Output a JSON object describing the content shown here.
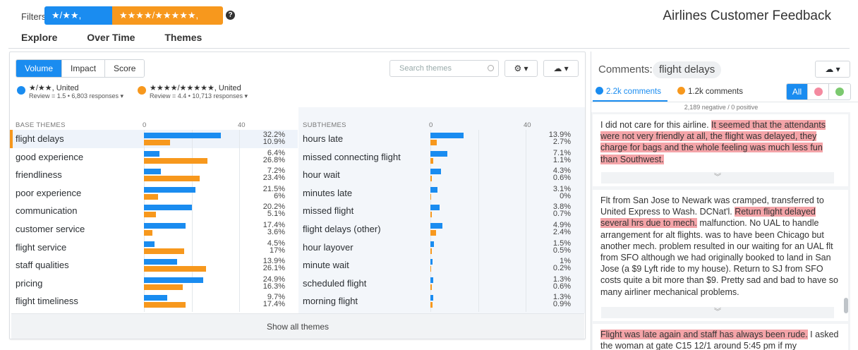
{
  "filters": {
    "label": "Filters",
    "chips": [
      {
        "label": "★/★★, United",
        "color": "#1a8cf0"
      },
      {
        "label": "★★★★/★★★★★, United",
        "color": "#f7981d"
      }
    ],
    "help": "?"
  },
  "app_title": "Airlines Customer Feedback",
  "nav": [
    "Explore",
    "Over Time",
    "Themes"
  ],
  "toolbar": {
    "modes": [
      "Volume",
      "Impact",
      "Score"
    ],
    "active_mode": "Volume",
    "search_placeholder": "Search themes",
    "gear_label": "⚙ ▾",
    "cloud_label": "☁ ▾"
  },
  "legend": [
    {
      "name": "★/★★, United",
      "sub": "Review = 1.5 • 6,803 responses ▾",
      "color": "#1a8cf0"
    },
    {
      "name": "★★★★/★★★★★, United",
      "sub": "Review = 4.4 • 10,713 responses ▾",
      "color": "#f7981d"
    }
  ],
  "base_themes": {
    "header": "BASE THEMES",
    "axis": [
      "0",
      "40"
    ],
    "rows": [
      {
        "label": "flight delays",
        "a": 32.2,
        "b": 10.9,
        "a_text": "32.2%",
        "b_text": "10.9%"
      },
      {
        "label": "good experience",
        "a": 6.4,
        "b": 26.8,
        "a_text": "6.4%",
        "b_text": "26.8%"
      },
      {
        "label": "friendliness",
        "a": 7.2,
        "b": 23.4,
        "a_text": "7.2%",
        "b_text": "23.4%"
      },
      {
        "label": "poor experience",
        "a": 21.5,
        "b": 6,
        "a_text": "21.5%",
        "b_text": "6%"
      },
      {
        "label": "communication",
        "a": 20.2,
        "b": 5.1,
        "a_text": "20.2%",
        "b_text": "5.1%"
      },
      {
        "label": "customer service",
        "a": 17.4,
        "b": 3.6,
        "a_text": "17.4%",
        "b_text": "3.6%"
      },
      {
        "label": "flight service",
        "a": 4.5,
        "b": 17,
        "a_text": "4.5%",
        "b_text": "17%"
      },
      {
        "label": "staff qualities",
        "a": 13.9,
        "b": 26.1,
        "a_text": "13.9%",
        "b_text": "26.1%"
      },
      {
        "label": "pricing",
        "a": 24.9,
        "b": 16.3,
        "a_text": "24.9%",
        "b_text": "16.3%"
      },
      {
        "label": "flight timeliness",
        "a": 9.7,
        "b": 17.4,
        "a_text": "9.7%",
        "b_text": "17.4%"
      }
    ]
  },
  "subthemes": {
    "header": "SUBTHEMES",
    "axis": [
      "0",
      "40"
    ],
    "rows": [
      {
        "label": "hours late",
        "a": 13.9,
        "b": 2.7,
        "a_text": "13.9%",
        "b_text": "2.7%"
      },
      {
        "label": "missed connecting flight",
        "a": 7.1,
        "b": 1.1,
        "a_text": "7.1%",
        "b_text": "1.1%"
      },
      {
        "label": "hour wait",
        "a": 4.3,
        "b": 0.6,
        "a_text": "4.3%",
        "b_text": "0.6%"
      },
      {
        "label": "minutes late",
        "a": 3.1,
        "b": 0,
        "a_text": "3.1%",
        "b_text": "0%"
      },
      {
        "label": "missed flight",
        "a": 3.8,
        "b": 0.7,
        "a_text": "3.8%",
        "b_text": "0.7%"
      },
      {
        "label": "flight delays (other)",
        "a": 4.9,
        "b": 2.4,
        "a_text": "4.9%",
        "b_text": "2.4%"
      },
      {
        "label": "hour layover",
        "a": 1.5,
        "b": 0.5,
        "a_text": "1.5%",
        "b_text": "0.5%"
      },
      {
        "label": "minute wait",
        "a": 1,
        "b": 0.2,
        "a_text": "1%",
        "b_text": "0.2%"
      },
      {
        "label": "scheduled flight",
        "a": 1.3,
        "b": 0.6,
        "a_text": "1.3%",
        "b_text": "0.6%"
      },
      {
        "label": "morning flight",
        "a": 1.3,
        "b": 0.9,
        "a_text": "1.3%",
        "b_text": "0.9%"
      }
    ]
  },
  "show_all_label": "Show all themes",
  "comments": {
    "label": "Comments:",
    "theme": "flight delays",
    "cloud_label": "☁ ▾",
    "tabs": [
      {
        "label": "2.2k comments",
        "color": "#1a8cf0"
      },
      {
        "label": "1.2k comments",
        "color": "#f7981d"
      }
    ],
    "filter_all": "All",
    "summary": "2,189 negative / 0 positive",
    "items": [
      {
        "before": "I did not care for this airline. ",
        "highlight": "It seemed that the attendants were not very friendly at all, the flight was delayed, they charge for bags and the whole feeling was much less fun than Southwest.",
        "after": ""
      },
      {
        "before": "Flt from San Jose to Newark was cramped, transferred to United Express to Wash. DCNat'l. ",
        "highlight": "Return flight delayed several hrs due to mech.",
        "after": " malfunction. No UAL to handle arrangement for alt flights. was to have been Chicago but another mech. problem resulted in our waiting for an UAL flt from SFO although we had originally booked to land in San Jose (a $9 Lyft ride to my house). Return to SJ from SFO costs quite a bit more than $9. Pretty sad and bad to have so many airliner mechanical problems."
      },
      {
        "before": "",
        "highlight": "Flight was late again and staff has always been rude.",
        "after": " I asked the woman at gate C15 12/1 around 5:45 pm if my"
      }
    ],
    "expand_glyph": "︾"
  }
}
